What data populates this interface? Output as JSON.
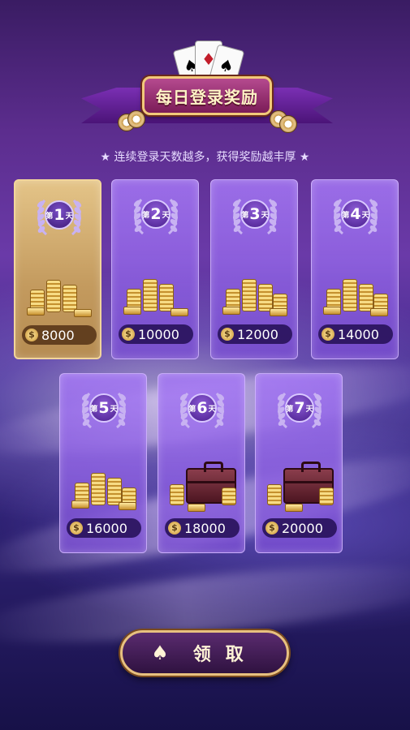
{
  "header": {
    "title": "每日登录奖励",
    "subtitle": "★ 连续登录天数越多，获得奖励越丰厚 ★"
  },
  "days": [
    {
      "prefix": "第",
      "num": "1",
      "suffix": "天",
      "amount": "8000",
      "reward": "coins",
      "active": true
    },
    {
      "prefix": "第",
      "num": "2",
      "suffix": "天",
      "amount": "10000",
      "reward": "coins",
      "active": false
    },
    {
      "prefix": "第",
      "num": "3",
      "suffix": "天",
      "amount": "12000",
      "reward": "coins",
      "active": false
    },
    {
      "prefix": "第",
      "num": "4",
      "suffix": "天",
      "amount": "14000",
      "reward": "coins",
      "active": false
    },
    {
      "prefix": "第",
      "num": "5",
      "suffix": "天",
      "amount": "16000",
      "reward": "coins",
      "active": false
    },
    {
      "prefix": "第",
      "num": "6",
      "suffix": "天",
      "amount": "18000",
      "reward": "briefcase",
      "active": false
    },
    {
      "prefix": "第",
      "num": "7",
      "suffix": "天",
      "amount": "20000",
      "reward": "briefcase",
      "active": false
    }
  ],
  "claim_button": {
    "label": "领取",
    "icon": "spade-icon"
  },
  "colors": {
    "accent_gold": "#f2d59a",
    "tile_purple": "#a578f5",
    "button_border": "#e8c07f"
  }
}
